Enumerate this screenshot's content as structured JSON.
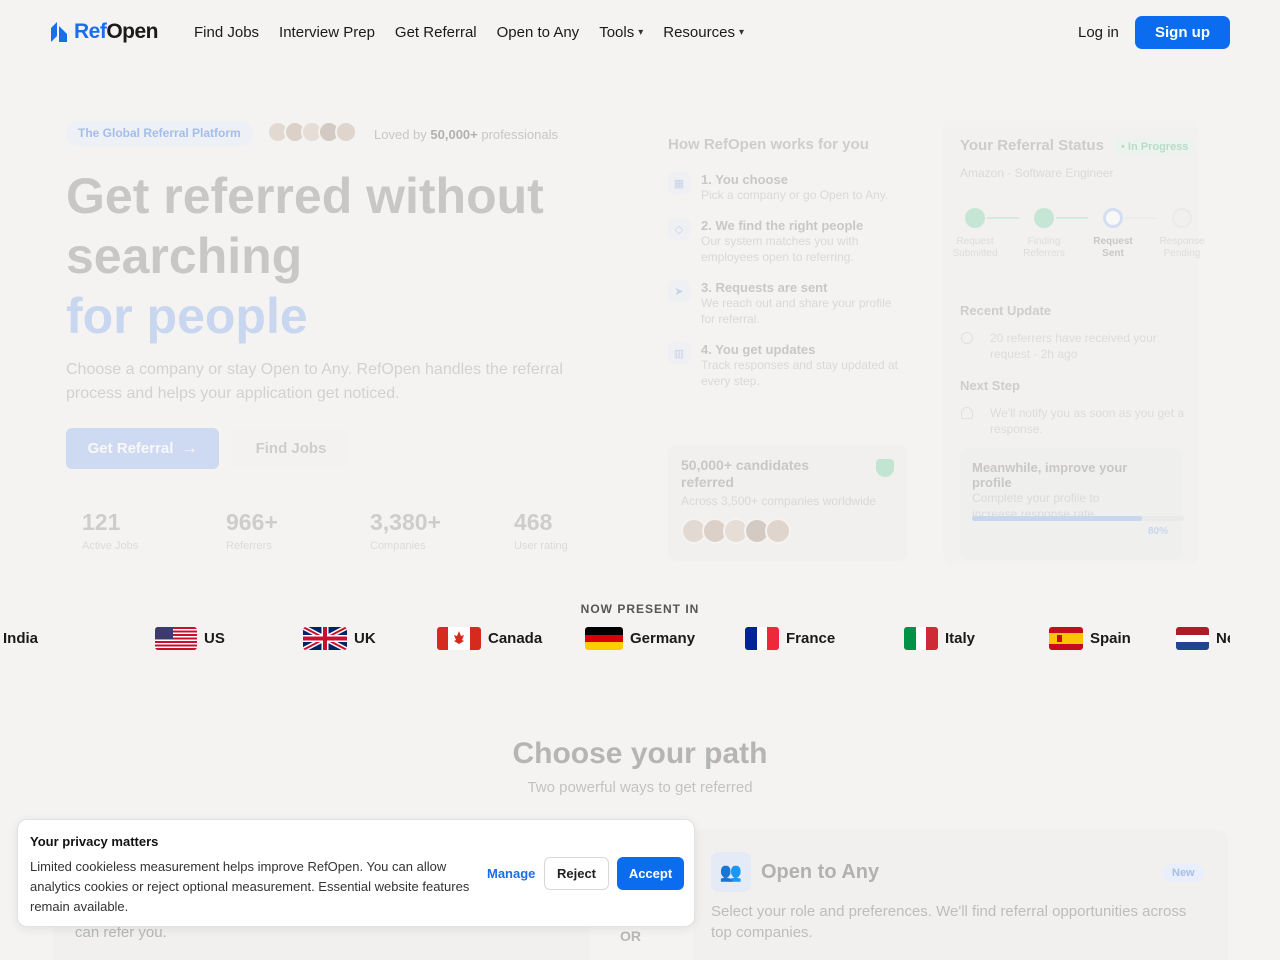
{
  "nav": {
    "logo_ref": "Ref",
    "logo_open": "Open",
    "links": [
      "Find Jobs",
      "Interview Prep",
      "Get Referral",
      "Open to Any",
      "Tools",
      "Resources"
    ],
    "login": "Log in",
    "signup": "Sign up"
  },
  "hero": {
    "badge": "The Global Referral Platform",
    "loved_prefix": "Loved by",
    "loved_count": "50,000+",
    "loved_suffix": "professionals",
    "title_line1": "Get referred without",
    "title_line2": "searching",
    "title_line3": "for people",
    "subtitle": "Choose a company or stay Open to Any. RefOpen handles the referral process and helps your application get noticed.",
    "btn_referral": "Get Referral",
    "btn_jobs": "Find Jobs",
    "stats": [
      {
        "value": "121",
        "label": "Active Jobs"
      },
      {
        "value": "966+",
        "label": "Referrers"
      },
      {
        "value": "3,380+",
        "label": "Companies"
      },
      {
        "value": "468",
        "label": "User rating"
      }
    ]
  },
  "how": {
    "title": "How RefOpen works for you",
    "steps": [
      {
        "title": "1. You choose",
        "desc": "Pick a company or go Open to Any."
      },
      {
        "title": "2. We find the right people",
        "desc": "Our system matches you with employees open to referring."
      },
      {
        "title": "3. Requests are sent",
        "desc": "We reach out and share your profile for referral."
      },
      {
        "title": "4. You get updates",
        "desc": "Track responses and stay updated at every step."
      }
    ],
    "candidates_title": "50,000+ candidates referred",
    "candidates_sub": "Across 3,500+ companies worldwide"
  },
  "status": {
    "title": "Your Referral Status",
    "pill": "• In Progress",
    "company": "Amazon · Software Engineer",
    "steps": [
      "Request Submitted",
      "Finding Referrers",
      "Request Sent",
      "Response Pending"
    ],
    "recent_title": "Recent Update",
    "recent_text": "20 referrers have received your request · 2h ago",
    "next_title": "Next Step",
    "next_text": "We'll notify you as soon as you get a response.",
    "improve_title": "Meanwhile, improve your profile",
    "improve_desc": "Complete your profile to increase response rate.",
    "improve_pct": "80%",
    "improve_value": 0.8
  },
  "present": {
    "title": "NOW PRESENT IN",
    "countries": [
      "India",
      "US",
      "UK",
      "Canada",
      "Germany",
      "France",
      "Italy",
      "Spain",
      "Netherlands"
    ]
  },
  "path": {
    "title": "Choose your path",
    "subtitle": "Two powerful ways to get referred",
    "left_text": "can refer you.",
    "or": "OR",
    "any_title": "Open to Any",
    "any_badge": "New",
    "any_desc": "Select your role and preferences. We'll find referral opportunities across top companies."
  },
  "cookie": {
    "title": "Your privacy matters",
    "body": "Limited cookieless measurement helps improve RefOpen. You can allow analytics cookies or reject optional measurement. Essential website features remain available.",
    "manage": "Manage",
    "reject": "Reject",
    "accept": "Accept"
  },
  "colors": {
    "brand": "#0b6cf0",
    "background": "#f4f3f1"
  }
}
